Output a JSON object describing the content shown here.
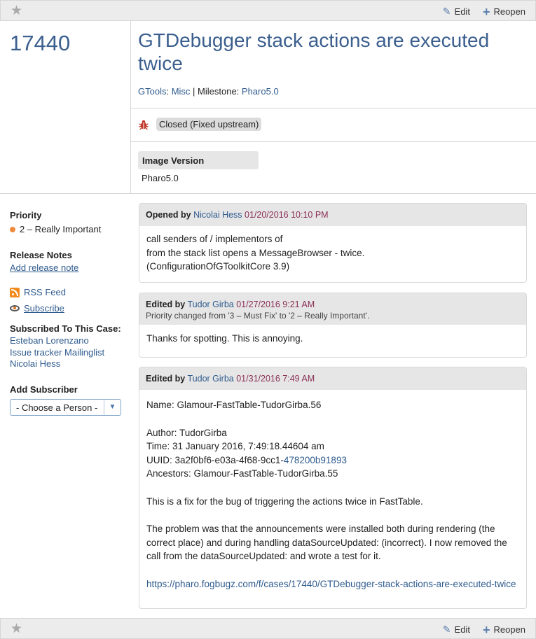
{
  "toolbar": {
    "edit_label": "Edit",
    "reopen_label": "Reopen"
  },
  "case": {
    "number": "17440",
    "title": "GTDebugger stack actions are executed twice",
    "project": "GTools",
    "area": "Misc",
    "milestone_label": "Milestone:",
    "milestone": "Pharo5.0",
    "status": "Closed (Fixed upstream)",
    "image_version_label": "Image Version",
    "image_version": "Pharo5.0"
  },
  "sidebar": {
    "priority_label": "Priority",
    "priority_value": "2 – Really Important",
    "release_notes_label": "Release Notes",
    "add_release_note": "Add release note",
    "rss_feed": "RSS Feed",
    "subscribe": "Subscribe",
    "subscribed_label": "Subscribed To This Case:",
    "subscribers": [
      "Esteban Lorenzano",
      "Issue tracker Mailinglist",
      "Nicolai Hess"
    ],
    "add_subscriber_label": "Add Subscriber",
    "choose_person": "- Choose a Person -"
  },
  "events": [
    {
      "action": "Opened by",
      "author": "Nicolai Hess",
      "date": "01/20/2016 10:10 PM",
      "lines": [
        "call senders of / implementors of",
        "from the stack list opens a MessageBrowser - twice.",
        "(ConfigurationOfGToolkitCore 3.9)"
      ]
    },
    {
      "action": "Edited by",
      "author": "Tudor Girba",
      "date": "01/27/2016 9:21 AM",
      "change": "Priority changed from '3 – Must Fix' to '2 – Really Important'.",
      "lines": [
        "Thanks for spotting. This is annoying."
      ]
    },
    {
      "action": "Edited by",
      "author": "Tudor Girba",
      "date": "01/31/2016 7:49 AM",
      "name_line": "Name: Glamour-FastTable-TudorGirba.56",
      "author_line": "Author: TudorGirba",
      "time_line": "Time: 31 January 2016, 7:49:18.44604 am",
      "uuid_prefix": "UUID: 3a2f0bf6-e03a-4f68-9cc1-",
      "uuid_link": "478200b91893",
      "ancestors_line": "Ancestors: Glamour-FastTable-TudorGirba.55",
      "fix_line": "This is a fix for the bug of triggering the actions twice in FastTable.",
      "problem_line": "The problem was that the announcements were installed both during rendering (the correct place) and during handling dataSourceUpdated: (incorrect). I now removed the call from the dataSourceUpdated: and wrote a test for it.",
      "url": "https://pharo.fogbugz.com/f/cases/17440/GTDebugger-stack-actions-are-executed-twice"
    }
  ]
}
